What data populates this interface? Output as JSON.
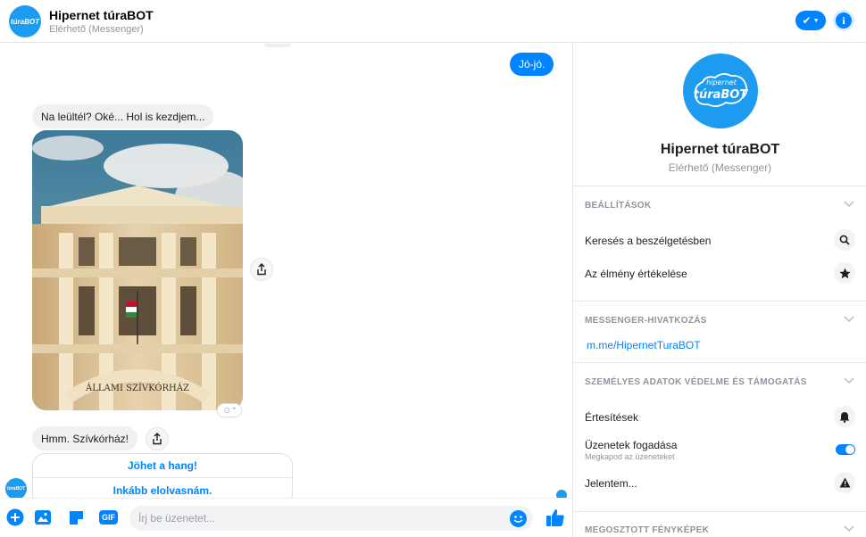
{
  "header": {
    "title": "Hipernet túraBOT",
    "status": "Elérhető (Messenger)",
    "avatar_text": "túraBOT"
  },
  "messages": {
    "outgoing_1": "Jó-jó.",
    "incoming_1": "Na leültél? Oké... Hol is kezdjem...",
    "photo_caption": "ÁLLAMI SZÍVKÓRHÁZ",
    "incoming_2": "Hmm. Szívkórház!",
    "reaction_button": "☺⁺"
  },
  "quick_replies": [
    "Jöhet a hang!",
    "Inkább elolvasnám."
  ],
  "composer": {
    "placeholder": "Írj be üzenetet...",
    "gif_label": "GIF"
  },
  "panel": {
    "name": "Hipernet túraBOT",
    "status": "Elérhető (Messenger)",
    "logo_text_small": "hipernet",
    "logo_text_big": "túraBOT",
    "sections": {
      "settings": {
        "title": "BEÁLLÍTÁSOK",
        "items": [
          "Keresés a beszélgetésben",
          "Az élmény értékelése"
        ]
      },
      "link": {
        "title": "MESSENGER-HIVATKOZÁS",
        "url": "m.me/HipernetTuraBOT"
      },
      "privacy": {
        "title": "SZEMÉLYES ADATOK VÉDELME ÉS TÁMOGATÁS",
        "notifications": "Értesítések",
        "receive": "Üzenetek fogadása",
        "receive_sub": "Megkapod az üzeneteket",
        "receive_on": true,
        "report": "Jelentem..."
      },
      "photos": {
        "title": "MEGOSZTOTT FÉNYKÉPEK"
      }
    }
  },
  "colors": {
    "accent": "#0084ff",
    "brand": "#1d9bf0"
  }
}
